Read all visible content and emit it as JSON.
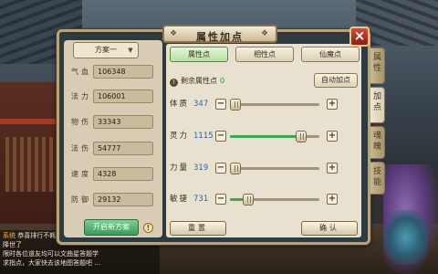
{
  "panel": {
    "title": "属性加点",
    "close_label": "×"
  },
  "side_tabs": [
    {
      "label": "属性",
      "active": false
    },
    {
      "label": "加点",
      "active": true
    },
    {
      "label": "魂魄",
      "active": false
    },
    {
      "label": "技能",
      "active": false
    }
  ],
  "plan": {
    "selected": "方案一",
    "caret": "▼",
    "new_plan_label": "开启新方案",
    "info_icon": "!"
  },
  "stats": [
    {
      "label": "气血",
      "value": "106348"
    },
    {
      "label": "法力",
      "value": "106001"
    },
    {
      "label": "物伤",
      "value": "33343"
    },
    {
      "label": "法伤",
      "value": "54777"
    },
    {
      "label": "速度",
      "value": "4328"
    },
    {
      "label": "防御",
      "value": "29132"
    }
  ],
  "tabs": [
    {
      "label": "属性点",
      "active": true
    },
    {
      "label": "相性点",
      "active": false
    },
    {
      "label": "仙魔点",
      "active": false
    }
  ],
  "remaining": {
    "icon": "!",
    "label": "剩余属性点",
    "value": "0"
  },
  "auto_button": "自动加点",
  "attributes": [
    {
      "name": "体质",
      "value": "347",
      "level": 0.0
    },
    {
      "name": "灵力",
      "value": "1115",
      "level": 0.8
    },
    {
      "name": "力量",
      "value": "319",
      "level": 0.0
    },
    {
      "name": "敏捷",
      "value": "731",
      "level": 0.2
    }
  ],
  "stepper": {
    "minus": "−",
    "plus": "+"
  },
  "bottom_info_icon": "!",
  "buttons": {
    "reset": "重置",
    "confirm": "确认"
  },
  "chat": [
    {
      "prefix": "系统",
      "text": "恭喜排行不耗…"
    },
    {
      "prefix": "",
      "text": "降世了"
    },
    {
      "prefix": "",
      "text": "限时各位道友均可以文曲星答题学"
    },
    {
      "prefix": "",
      "text": "求指点，大家快去该地图答题吧 …"
    }
  ],
  "colors": {
    "accent": "#3aa84a",
    "value_blue": "#2a6aa0",
    "frame": "#b9a37a",
    "close_red": "#c0392b"
  }
}
